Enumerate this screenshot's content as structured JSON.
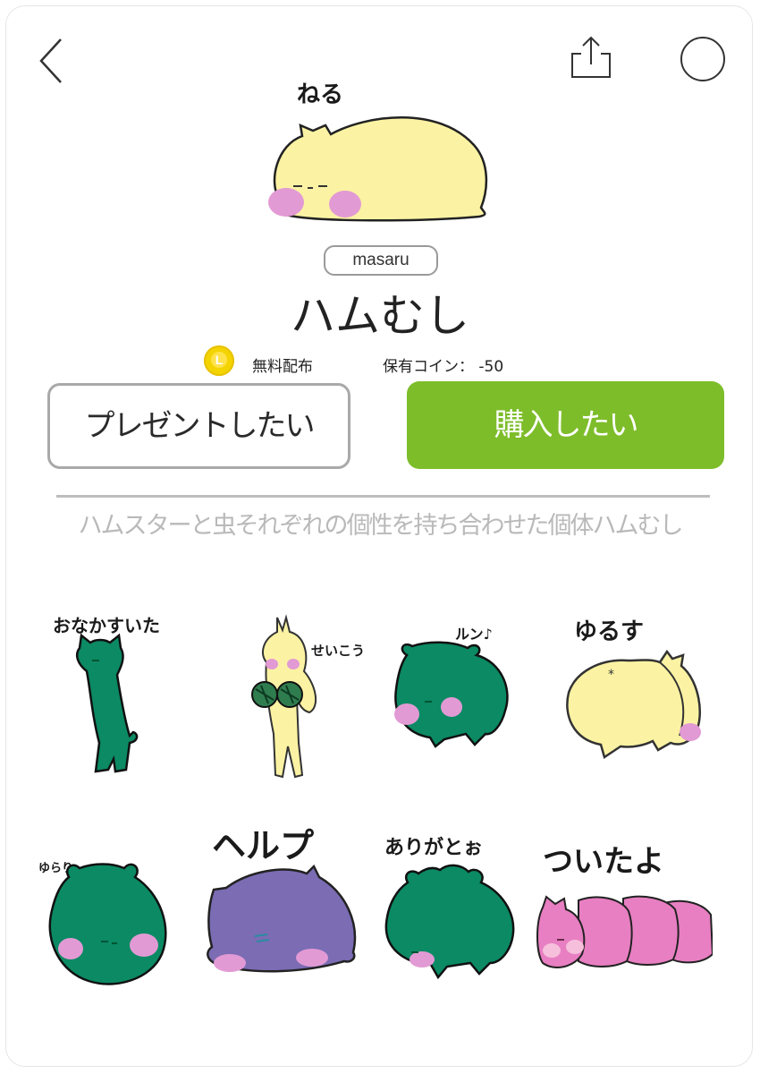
{
  "header": {
    "back_icon": "chevron-left-icon",
    "share_icon": "share-icon",
    "menu_icon": "circle-icon"
  },
  "hero": {
    "caption": "ねる"
  },
  "product": {
    "author": "masaru",
    "title": "ハムむし",
    "coin_badge": "L",
    "price_label": "無料配布",
    "coins_label": "保有コイン： -50"
  },
  "buttons": {
    "gift_label": "プレゼントしたい",
    "buy_label": "購入したい"
  },
  "description": "ハムスターと虫それぞれの個性を持ち合わせた個体ハムむし",
  "stickers": [
    {
      "caption": "おなかすいた"
    },
    {
      "caption": "せいこう"
    },
    {
      "caption": "ルン♪"
    },
    {
      "caption": "ゆるす"
    },
    {
      "caption": "ゆらり"
    },
    {
      "caption": "ヘルプ"
    },
    {
      "caption": "ありがとぉ"
    },
    {
      "caption": "ついたよ"
    }
  ],
  "colors": {
    "accent_green": "#7dbd2a",
    "hamster_yellow": "#fbf3a3",
    "bug_green": "#0b8a64",
    "purple": "#7b6cb4",
    "pink": "#e87fc2"
  }
}
